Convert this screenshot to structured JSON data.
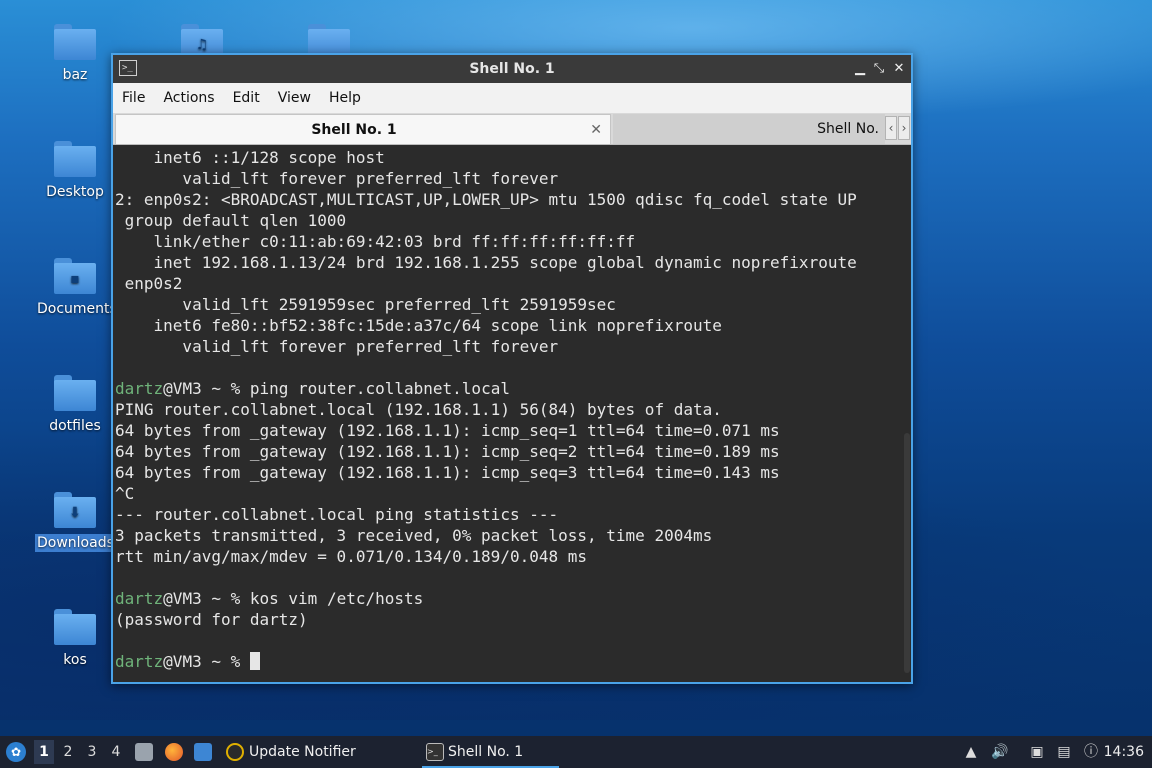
{
  "desktop": {
    "icons": [
      {
        "label": "baz",
        "glyph": ""
      },
      {
        "label": "",
        "glyph": "♫"
      },
      {
        "label": "",
        "glyph": ""
      },
      {
        "label": "Desktop",
        "glyph": ""
      },
      {
        "label": "Documents",
        "glyph": "▪"
      },
      {
        "label": "dotfiles",
        "glyph": ""
      },
      {
        "label": "Downloads",
        "glyph": "⬇"
      },
      {
        "label": "kos",
        "glyph": ""
      }
    ]
  },
  "window": {
    "title": "Shell No. 1",
    "app_icon": ">_",
    "buttons": {
      "minimize": "▁",
      "maximize": "⤡",
      "close": "✕"
    },
    "menu": [
      "File",
      "Actions",
      "Edit",
      "View",
      "Help"
    ],
    "tabs": [
      {
        "label": "Shell No. 1",
        "active": true,
        "close": "✕"
      },
      {
        "label": "Shell No.",
        "active": false
      }
    ],
    "tab_scroll": {
      "left": "‹",
      "right": "›"
    }
  },
  "terminal": {
    "lines": [
      {
        "text": "    inet6 ::1/128 scope host"
      },
      {
        "text": "       valid_lft forever preferred_lft forever"
      },
      {
        "text": "2: enp0s2: <BROADCAST,MULTICAST,UP,LOWER_UP> mtu 1500 qdisc fq_codel state UP"
      },
      {
        "text": " group default qlen 1000"
      },
      {
        "text": "    link/ether c0:11:ab:69:42:03 brd ff:ff:ff:ff:ff:ff"
      },
      {
        "text": "    inet 192.168.1.13/24 brd 192.168.1.255 scope global dynamic noprefixroute"
      },
      {
        "text": " enp0s2"
      },
      {
        "text": "       valid_lft 2591959sec preferred_lft 2591959sec"
      },
      {
        "text": "    inet6 fe80::bf52:38fc:15de:a37c/64 scope link noprefixroute"
      },
      {
        "text": "       valid_lft forever preferred_lft forever"
      },
      {
        "text": ""
      },
      {
        "user": "dartz",
        "prompt": "@VM3 ~ % ",
        "text": "ping router.collabnet.local"
      },
      {
        "text": "PING router.collabnet.local (192.168.1.1) 56(84) bytes of data."
      },
      {
        "text": "64 bytes from _gateway (192.168.1.1): icmp_seq=1 ttl=64 time=0.071 ms"
      },
      {
        "text": "64 bytes from _gateway (192.168.1.1): icmp_seq=2 ttl=64 time=0.189 ms"
      },
      {
        "text": "64 bytes from _gateway (192.168.1.1): icmp_seq=3 ttl=64 time=0.143 ms"
      },
      {
        "text": "^C"
      },
      {
        "text": "--- router.collabnet.local ping statistics ---"
      },
      {
        "text": "3 packets transmitted, 3 received, 0% packet loss, time 2004ms"
      },
      {
        "text": "rtt min/avg/max/mdev = 0.071/0.134/0.189/0.048 ms"
      },
      {
        "text": ""
      },
      {
        "user": "dartz",
        "prompt": "@VM3 ~ % ",
        "text": "kos vim /etc/hosts"
      },
      {
        "text": "(password for dartz)"
      },
      {
        "text": ""
      },
      {
        "user": "dartz",
        "prompt": "@VM3 ~ % ",
        "text": "",
        "cursor": true
      }
    ],
    "colors": {
      "background": "#2b2b2b",
      "foreground": "#e6e6e6",
      "user": "#6fb37a"
    }
  },
  "taskbar": {
    "workspaces": [
      "1",
      "2",
      "3",
      "4"
    ],
    "active_workspace": "1",
    "tasks": [
      {
        "label": "Update Notifier",
        "icon": "update-icon"
      },
      {
        "label": "Shell No. 1",
        "icon": "terminal-icon"
      }
    ],
    "clock": "14:36"
  }
}
